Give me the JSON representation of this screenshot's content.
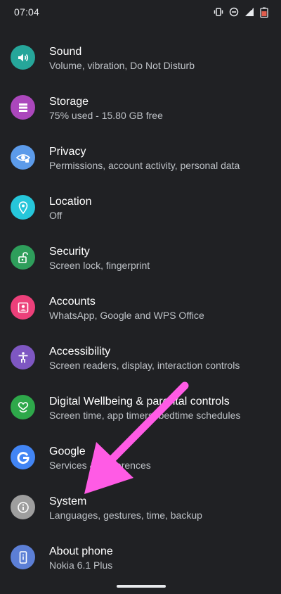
{
  "status_bar": {
    "time": "07:04",
    "icons": [
      "vibrate-icon",
      "do-not-disturb-icon",
      "signal-icon",
      "battery-icon"
    ]
  },
  "settings": {
    "items": [
      {
        "title": "Sound",
        "subtitle": "Volume, vibration, Do Not Disturb",
        "icon": "sound-icon",
        "color": "#26a69a"
      },
      {
        "title": "Storage",
        "subtitle": "75% used - 15.80 GB free",
        "icon": "storage-icon",
        "color": "#ab47bc"
      },
      {
        "title": "Privacy",
        "subtitle": "Permissions, account activity, personal data",
        "icon": "privacy-eye-icon",
        "color": "#5c9bea"
      },
      {
        "title": "Location",
        "subtitle": "Off",
        "icon": "location-pin-icon",
        "color": "#26c6da"
      },
      {
        "title": "Security",
        "subtitle": "Screen lock, fingerprint",
        "icon": "lock-icon",
        "color": "#2e9e5b"
      },
      {
        "title": "Accounts",
        "subtitle": "WhatsApp, Google and WPS Office",
        "icon": "account-icon",
        "color": "#ec407a"
      },
      {
        "title": "Accessibility",
        "subtitle": "Screen readers, display, interaction controls",
        "icon": "accessibility-icon",
        "color": "#7e57c2"
      },
      {
        "title": "Digital Wellbeing & parental controls",
        "subtitle": "Screen time, app timers, bedtime schedules",
        "icon": "wellbeing-heart-icon",
        "color": "#2ea84a"
      },
      {
        "title": "Google",
        "subtitle": "Services & preferences",
        "icon": "google-g-icon",
        "color": "#4285f4"
      },
      {
        "title": "System",
        "subtitle": "Languages, gestures, time, backup",
        "icon": "info-icon",
        "color": "#9e9e9e"
      },
      {
        "title": "About phone",
        "subtitle": "Nokia 6.1 Plus",
        "icon": "phone-icon",
        "color": "#5c7fd6"
      }
    ]
  },
  "colors": {
    "background": "#202124",
    "annotation_arrow": "#ff5be5"
  }
}
